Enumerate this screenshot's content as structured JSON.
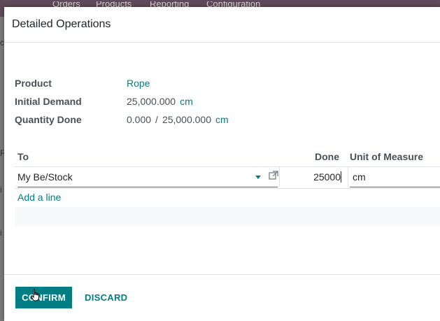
{
  "background": {
    "menu": [
      "Orders",
      "Products",
      "Reporting",
      "Configuration"
    ],
    "left_glyphs": [
      "c",
      "F",
      "i",
      "i"
    ]
  },
  "dialog": {
    "title": "Detailed Operations",
    "fields": {
      "product_label": "Product",
      "product_value": "Rope",
      "initial_demand_label": "Initial Demand",
      "initial_demand_value": "25,000.000",
      "initial_demand_uom": "cm",
      "quantity_done_label": "Quantity Done",
      "quantity_done_value": "0.000",
      "quantity_done_separator": "/",
      "quantity_done_total": "25,000.000",
      "quantity_done_uom": "cm"
    },
    "table": {
      "headers": {
        "to": "To",
        "done": "Done",
        "uom": "Unit of Measure"
      },
      "rows": [
        {
          "to": "My Be/Stock",
          "done": "25000",
          "uom": "cm"
        }
      ],
      "add_line": "Add a line"
    },
    "footer": {
      "confirm": "CONFIRM",
      "discard": "DISCARD"
    }
  },
  "colors": {
    "accent": "#017e84",
    "background_bar": "#5e4a58"
  },
  "icons": [
    "dropdown-caret-icon",
    "external-link-icon",
    "hand-pointer-icon"
  ]
}
